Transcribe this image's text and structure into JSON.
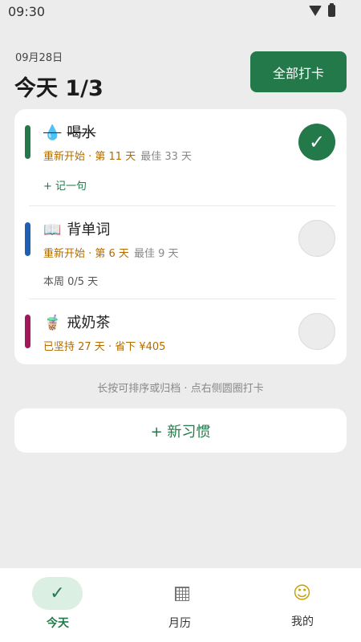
{
  "status_bar": {
    "time": "09:30"
  },
  "header": {
    "date": "09月28日",
    "title": "今天 1/3",
    "checkin_all_label": "全部打卡"
  },
  "habits": [
    {
      "emoji": "💧",
      "name": "喝水",
      "done": true,
      "accent_color": "#23794a",
      "streak": "重新开始 · 第 11 天",
      "best": "最佳 33 天",
      "extra": "+ 记一句"
    },
    {
      "emoji": "📖",
      "name": "背单词",
      "done": false,
      "accent_color": "#1e5fb4",
      "streak": "重新开始 · 第 6 天",
      "best": "最佳 9 天",
      "extra": "本周 0/5 天"
    },
    {
      "emoji": "🧋",
      "name": "戒奶茶",
      "done": false,
      "accent_color": "#a3185a",
      "streak": "已坚持 27 天 · 省下 ¥405",
      "best": "",
      "extra": ""
    }
  ],
  "check_glyph": "✓",
  "hint": "长按可排序或归档 · 点右侧圆圈打卡",
  "new_habit_label": "+ 新习惯",
  "nav": {
    "today": {
      "icon": "✓",
      "label": "今天",
      "active": true
    },
    "calendar": {
      "icon": "grid-icon",
      "label": "月历",
      "active": false
    },
    "me": {
      "icon": "☺",
      "label": "我的",
      "active": false
    }
  },
  "colors": {
    "accent": "#23794a",
    "background": "#ececec"
  }
}
